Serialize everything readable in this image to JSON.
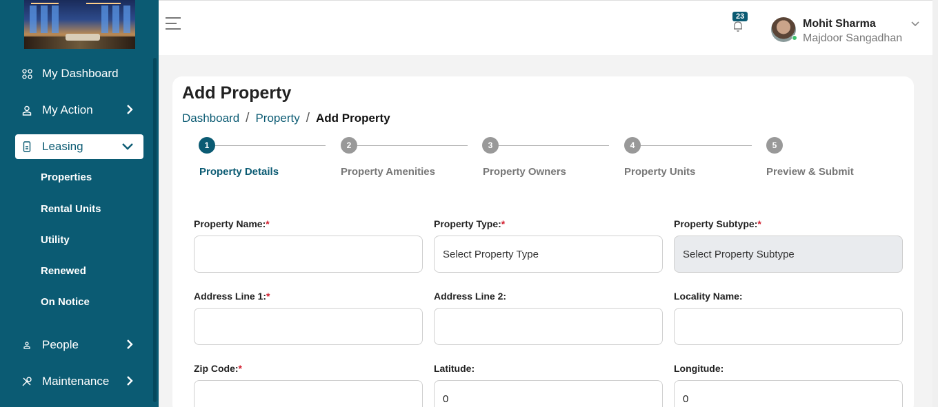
{
  "sidebar": {
    "items": [
      {
        "label": "My Dashboard",
        "icon": "grid-icon"
      },
      {
        "label": "My Action",
        "icon": "user-icon"
      },
      {
        "label": "Leasing",
        "icon": "document-icon"
      },
      {
        "label": "People",
        "icon": "people-icon"
      },
      {
        "label": "Maintenance",
        "icon": "tools-icon"
      }
    ],
    "leasing_sub": [
      "Properties",
      "Rental Units",
      "Utility",
      "Renewed",
      "On Notice"
    ]
  },
  "header": {
    "notification_count": "23",
    "user_name": "Mohit Sharma",
    "user_org": "Majdoor Sangadhan"
  },
  "page": {
    "title": "Add Property",
    "breadcrumb": [
      "Dashboard",
      "Property",
      "Add Property"
    ]
  },
  "steps": [
    {
      "num": "1",
      "label": "Property Details"
    },
    {
      "num": "2",
      "label": "Property Amenities"
    },
    {
      "num": "3",
      "label": "Property Owners"
    },
    {
      "num": "4",
      "label": "Property Units"
    },
    {
      "num": "5",
      "label": "Preview & Submit"
    }
  ],
  "form": {
    "property_name": {
      "label": "Property Name:",
      "value": ""
    },
    "property_type": {
      "label": "Property Type:",
      "placeholder": "Select Property Type"
    },
    "property_subtype": {
      "label": "Property Subtype:",
      "placeholder": "Select Property Subtype"
    },
    "address1": {
      "label": "Address Line 1:",
      "value": ""
    },
    "address2": {
      "label": "Address Line 2:",
      "value": ""
    },
    "locality": {
      "label": "Locality Name:",
      "value": ""
    },
    "zip": {
      "label": "Zip Code:",
      "value": ""
    },
    "latitude": {
      "label": "Latitude:",
      "value": "0"
    },
    "longitude": {
      "label": "Longitude:",
      "value": "0"
    },
    "required_mark": "*"
  },
  "colors": {
    "primary": "#0b5b73",
    "required": "#d21f2f"
  }
}
